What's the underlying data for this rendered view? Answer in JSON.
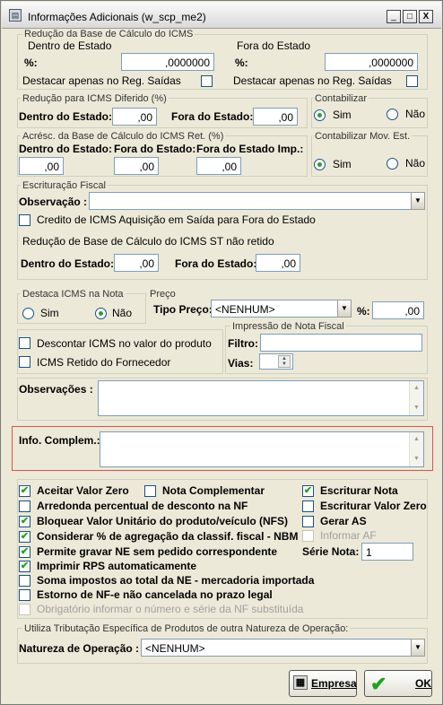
{
  "window": {
    "title": "Informações Adicionais (w_scp_me2)",
    "buttons": {
      "minimize": "_",
      "maximize": "□",
      "close": "X"
    }
  },
  "base_icms": {
    "title": "Redução da Base de Cálculo do ICMS",
    "dentro": {
      "title": "Dentro de Estado",
      "pct_label": "%:",
      "pct_value": ",0000000",
      "destacar": "Destacar apenas no Reg. Saídas",
      "destacar_checked": false
    },
    "fora": {
      "title": "Fora do Estado",
      "pct_label": "%:",
      "pct_value": ",0000000",
      "destacar": "Destacar apenas no Reg. Saídas",
      "destacar_checked": false
    }
  },
  "diferido": {
    "title": "Redução para ICMS Diferido (%)",
    "dentro_label": "Dentro do Estado:",
    "dentro_value": ",00",
    "fora_label": "Fora do Estado:",
    "fora_value": ",00"
  },
  "contabilizar": {
    "title": "Contabilizar",
    "sim": "Sim",
    "nao": "Não",
    "selected": "sim"
  },
  "acresc": {
    "title": "Acrésc. da Base de Cálculo do ICMS Ret. (%)",
    "dentro_label": "Dentro do Estado:",
    "dentro_value": ",00",
    "fora_label": "Fora do Estado:",
    "fora_value": ",00",
    "fora_imp_label": "Fora do Estado Imp.:",
    "fora_imp_value": ",00"
  },
  "contabilizar_mov": {
    "title": "Contabilizar Mov. Est.",
    "sim": "Sim",
    "nao": "Não",
    "selected": "sim"
  },
  "escrituracao": {
    "title": "Escrituração Fiscal",
    "obs_label": "Observação :",
    "obs_value": "",
    "credito": "Credito de ICMS Aquisição em Saída para Fora do Estado",
    "credito_checked": false,
    "st_title": "Redução de Base de Cálculo do ICMS ST não retido",
    "dentro_label": "Dentro do Estado:",
    "dentro_value": ",00",
    "fora_label": "Fora do Estado:",
    "fora_value": ",00"
  },
  "destaca": {
    "title": "Destaca ICMS na Nota",
    "sim": "Sim",
    "nao": "Não",
    "selected": "nao"
  },
  "preco": {
    "title": "Preço",
    "tipo_label": "Tipo Preço:",
    "tipo_value": "<NENHUM>",
    "pct_label": "%:",
    "pct_value": ",00"
  },
  "impressao": {
    "title": "Impressão de Nota Fiscal",
    "filtro_label": "Filtro:",
    "filtro_value": "",
    "vias_label": "Vias:",
    "vias_value": ""
  },
  "descontar": "Descontar ICMS no valor do produto",
  "retido": "ICMS Retido do Fornecedor",
  "observacoes_label": "Observações :",
  "info_label": "Info. Complem.:",
  "options_left": [
    {
      "label": "Aceitar Valor Zero",
      "checked": true,
      "disabled": false
    },
    {
      "label": "Arredonda percentual de desconto na NF",
      "checked": false,
      "disabled": false
    },
    {
      "label": "Bloquear Valor Unitário do produto/veículo (NFS)",
      "checked": true,
      "disabled": false
    },
    {
      "label": "Considerar % de agregação da classif. fiscal - NBM",
      "checked": true,
      "disabled": false
    },
    {
      "label": "Permite gravar NE sem pedido correspondente",
      "checked": true,
      "disabled": false
    },
    {
      "label": "Imprimir RPS automaticamente",
      "checked": true,
      "disabled": false
    },
    {
      "label": "Soma impostos ao total da NE - mercadoria importada",
      "checked": false,
      "disabled": false
    },
    {
      "label": "Estorno de NF-e não cancelada no prazo legal",
      "checked": false,
      "disabled": false
    },
    {
      "label": "Obrigatório informar o número e série da NF substituída",
      "checked": false,
      "disabled": true
    }
  ],
  "nota_complementar": {
    "label": "Nota Complementar",
    "checked": false
  },
  "options_right": [
    {
      "label": "Escriturar Nota",
      "checked": true,
      "disabled": false
    },
    {
      "label": "Escriturar Valor Zero",
      "checked": false,
      "disabled": false
    },
    {
      "label": "Gerar AS",
      "checked": false,
      "disabled": false
    },
    {
      "label": "Informar AF",
      "checked": false,
      "disabled": true
    }
  ],
  "serie": {
    "label": "Série Nota:",
    "value": "1"
  },
  "tributacao": {
    "title": "Utiliza Tributação Específica de Produtos de outra Natureza de Operação:",
    "natureza_label": "Natureza de Operação :",
    "natureza_value": "<NENHUM>"
  },
  "buttons": {
    "empresa": "Empresa",
    "ok": "OK"
  },
  "colors": {
    "check": "#21a121",
    "highlight_border": "#d9534f",
    "field_border": "#7f9db9"
  }
}
